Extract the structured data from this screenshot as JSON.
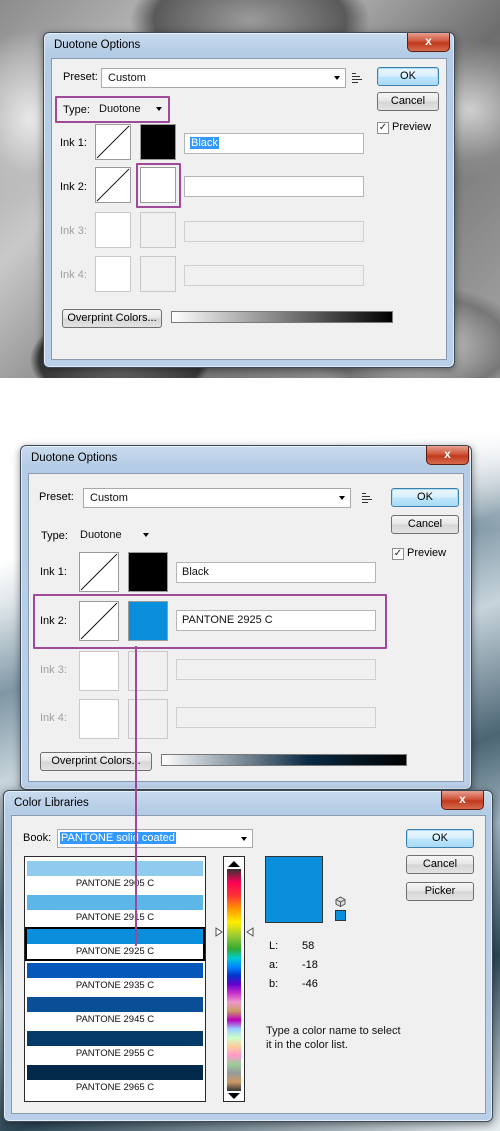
{
  "dialog1": {
    "title": "Duotone Options",
    "close": "x",
    "preset_label": "Preset:",
    "preset_value": "Custom",
    "type_label": "Type:",
    "type_value": "Duotone",
    "ink1_label": "Ink 1:",
    "ink1_name": "Black",
    "ink2_label": "Ink 2:",
    "ink2_name": "",
    "ink3_label": "Ink 3:",
    "ink4_label": "Ink 4:",
    "overprint": "Overprint Colors...",
    "ok": "OK",
    "cancel": "Cancel",
    "preview": "Preview",
    "check": "✓"
  },
  "dialog2": {
    "title": "Duotone Options",
    "close": "x",
    "preset_label": "Preset:",
    "preset_value": "Custom",
    "type_label": "Type:",
    "type_value": "Duotone",
    "ink1_label": "Ink 1:",
    "ink1_name": "Black",
    "ink2_label": "Ink 2:",
    "ink2_name": "PANTONE 2925 C",
    "ink3_label": "Ink 3:",
    "ink4_label": "Ink 4:",
    "overprint": "Overprint Colors...",
    "ok": "OK",
    "cancel": "Cancel",
    "preview": "Preview",
    "check": "✓"
  },
  "library": {
    "title": "Color Libraries",
    "close": "x",
    "book_label": "Book:",
    "book_value": "PANTONE solid coated",
    "ok": "OK",
    "cancel": "Cancel",
    "picker": "Picker",
    "lab_l_label": "L:",
    "lab_l": "58",
    "lab_a_label": "a:",
    "lab_a": "-18",
    "lab_b_label": "b:",
    "lab_b": "-46",
    "hint": "Type a color name to select it in the color list.",
    "items": [
      {
        "name": "PANTONE 2905 C",
        "color": "#8ecbee"
      },
      {
        "name": "PANTONE 2915 C",
        "color": "#5db6e8"
      },
      {
        "name": "PANTONE 2925 C",
        "color": "#0a8fdc"
      },
      {
        "name": "PANTONE 2935 C",
        "color": "#0557b9"
      },
      {
        "name": "PANTONE 2945 C",
        "color": "#0a4e98"
      },
      {
        "name": "PANTONE 2955 C",
        "color": "#053a6b"
      },
      {
        "name": "PANTONE 2965 C",
        "color": "#03294a"
      }
    ],
    "selected_color": "#0a8fdc"
  },
  "colors": {
    "highlight": "#a0489a",
    "ink1": "#000000",
    "ink2_dialog2": "#0a8fdc"
  }
}
